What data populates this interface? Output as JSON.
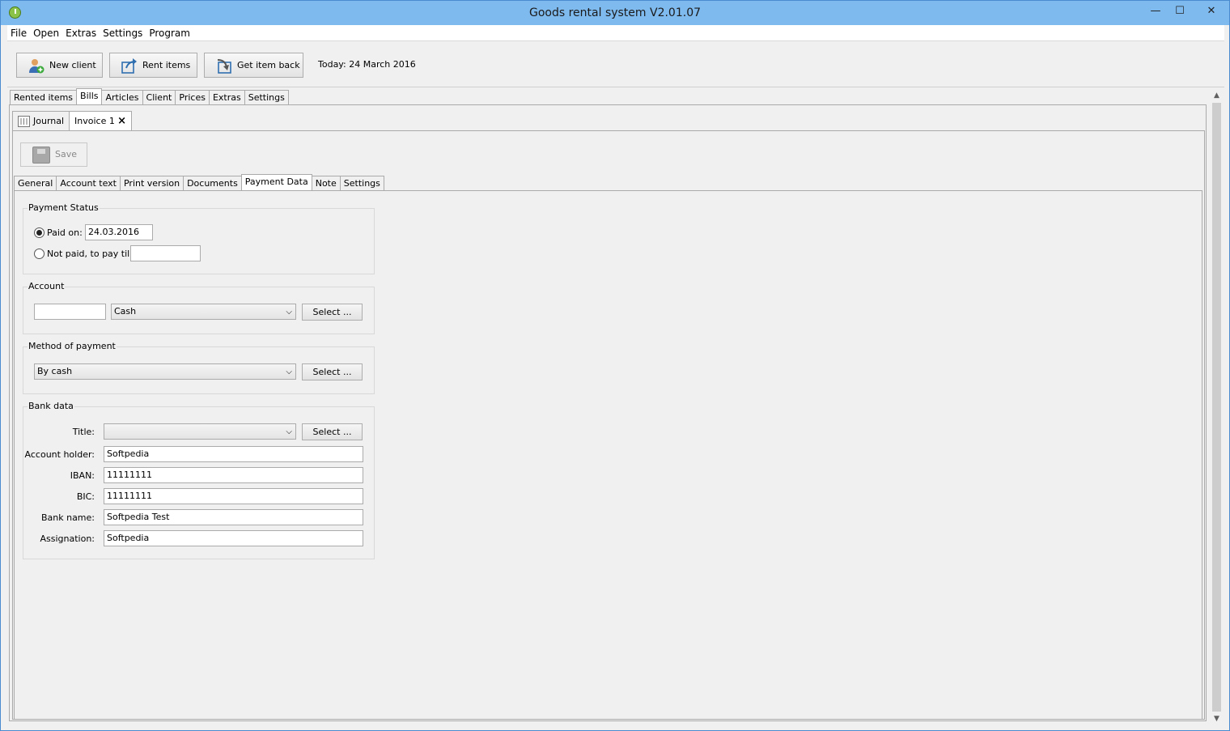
{
  "window": {
    "title": "Goods rental system V2.01.07",
    "min": "—",
    "max": "☐",
    "close": "✕"
  },
  "menu": [
    "File",
    "Open",
    "Extras",
    "Settings",
    "Program"
  ],
  "toolbar": {
    "new_client": "New client",
    "rent_items": "Rent items",
    "get_item_back": "Get item back",
    "today": "Today: 24 March 2016"
  },
  "main_tabs": [
    "Rented items",
    "Bills",
    "Articles",
    "Client",
    "Prices",
    "Extras",
    "Settings"
  ],
  "sub_tabs": {
    "journal": "Journal",
    "invoice": "Invoice 1",
    "close": "×"
  },
  "save_label": "Save",
  "invoice_tabs": [
    "General",
    "Account text",
    "Print version",
    "Documents",
    "Payment Data",
    "Note",
    "Settings"
  ],
  "payment_status": {
    "legend": "Payment Status",
    "paid_on_label": "Paid on:",
    "paid_on_value": "24.03.2016",
    "not_paid_label": "Not paid, to pay till:",
    "not_paid_value": ""
  },
  "account": {
    "legend": "Account",
    "code_value": "",
    "selected": "Cash",
    "select_label": "Select ..."
  },
  "method": {
    "legend": "Method of payment",
    "selected": "By cash",
    "select_label": "Select ..."
  },
  "bank": {
    "legend": "Bank data",
    "title_label": "Title:",
    "title_value": "",
    "select_label": "Select ...",
    "fields": [
      {
        "label": "Account holder:",
        "value": "Softpedia"
      },
      {
        "label": "IBAN:",
        "value": "11111111"
      },
      {
        "label": "BIC:",
        "value": "11111111"
      },
      {
        "label": "Bank name:",
        "value": "Softpedia Test"
      },
      {
        "label": "Assignation:",
        "value": "Softpedia"
      }
    ]
  },
  "colors": {
    "titlebar": "#7fbaef",
    "window_bg": "#f0f0f0"
  }
}
